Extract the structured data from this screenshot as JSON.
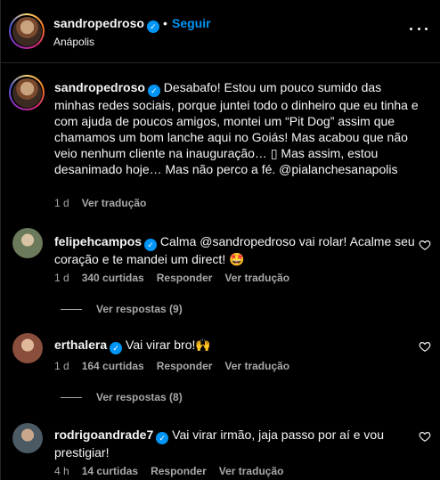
{
  "header": {
    "username": "sandropedroso",
    "dot": "•",
    "follow": "Seguir",
    "location": "Anápolis"
  },
  "caption": {
    "username": "sandropedroso",
    "text": "Desabafo! Estou um pouco sumido das minhas redes sociais, porque juntei todo o dinheiro que eu tinha e com ajuda de poucos amigos, montei um “Pit Dog” assim que chamamos um bom lanche aqui no Goiás! Mas acabou que não veio nenhum cliente na inauguração… ▯ Mas assim, estou desanimado hoje… Mas não perco a fé. @pialanchesanapolis",
    "time": "1 d",
    "translate": "Ver tradução"
  },
  "comments": [
    {
      "username": "felipehcampos",
      "text": "Calma @sandropedroso vai rolar! Acalme seu coração e te mandei um direct! 🤩",
      "time": "1 d",
      "likes": "340 curtidas",
      "reply": "Responder",
      "translate": "Ver tradução",
      "replies": "Ver respostas (9)"
    },
    {
      "username": "erthalera",
      "text": "Vai virar bro!🙌",
      "time": "1 d",
      "likes": "164 curtidas",
      "reply": "Responder",
      "translate": "Ver tradução",
      "replies": "Ver respostas (8)"
    },
    {
      "username": "rodrigoandrade7",
      "text": "Vai virar irmão, jaja passo por aí e vou prestigiar!",
      "time": "4 h",
      "likes": "14 curtidas",
      "reply": "Responder",
      "translate": "Ver tradução"
    }
  ],
  "colors": {
    "background": "#000000",
    "text": "#f5f5f5",
    "secondary": "#a8a8a8",
    "link": "#0095f6",
    "verified": "#0095f6"
  },
  "icons": {
    "verified": "verified-badge-icon",
    "more": "more-options-icon",
    "like": "heart-icon"
  }
}
